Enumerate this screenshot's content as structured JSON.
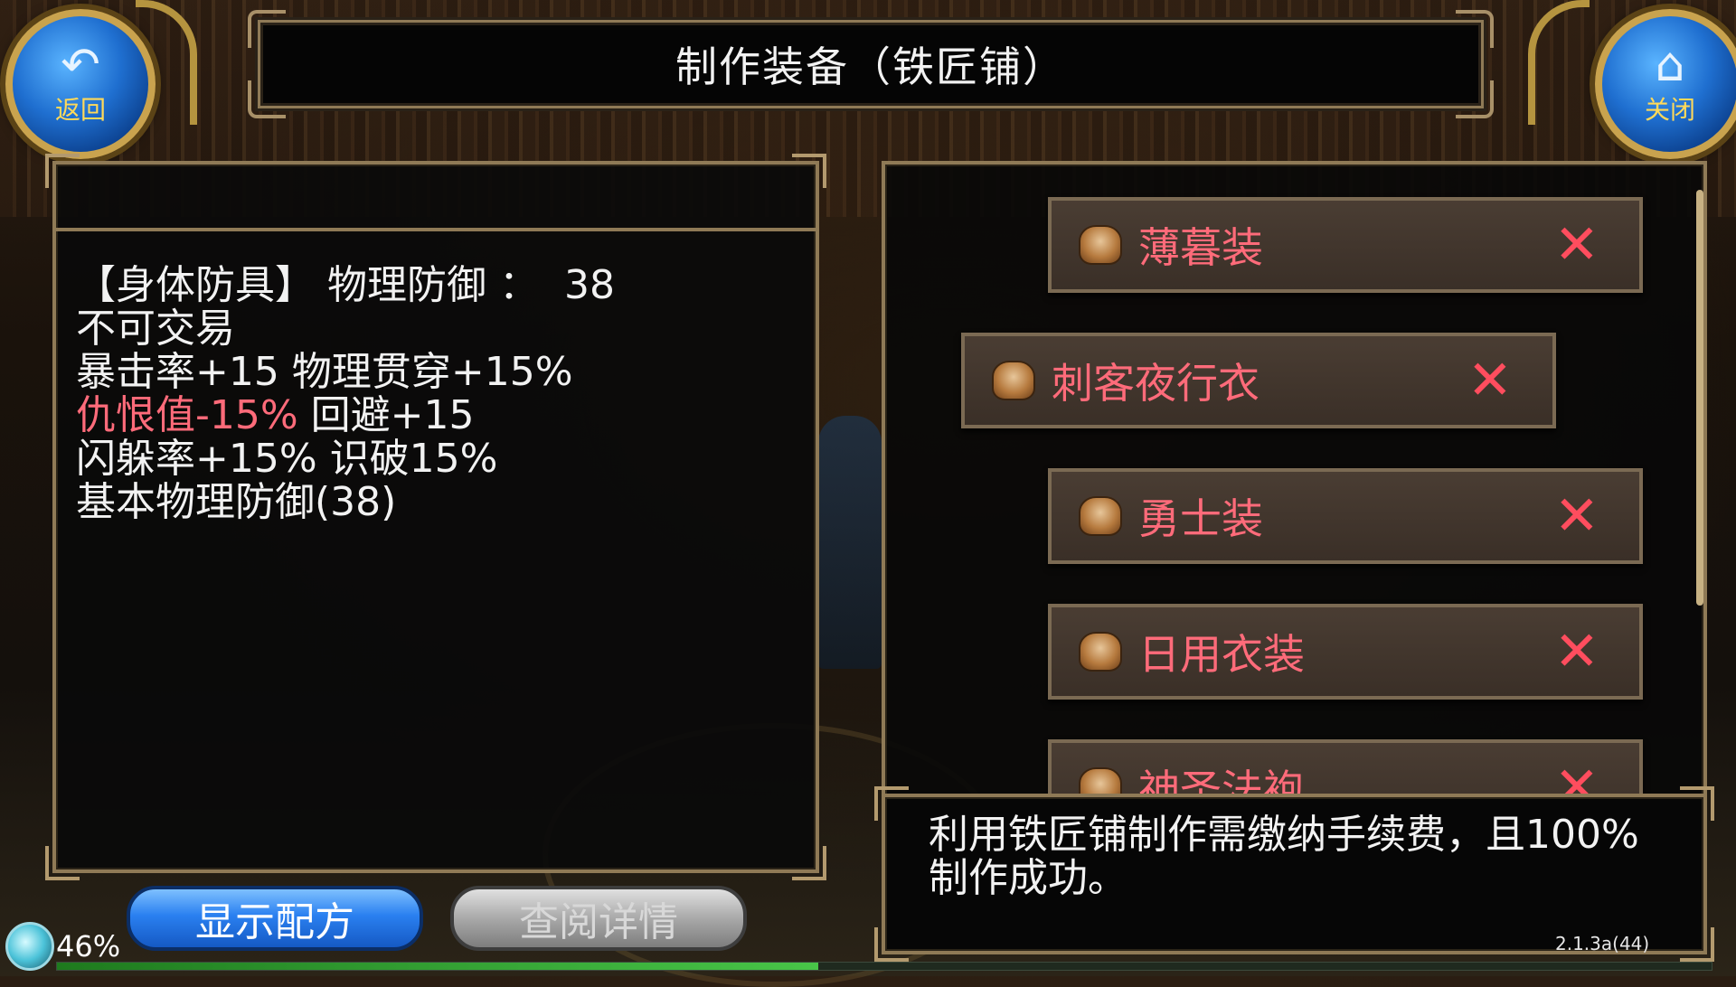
{
  "header": {
    "title": "制作装备（铁匠铺）",
    "back_label": "返回",
    "close_label": "关闭"
  },
  "item_detail": {
    "line1": "【身体防具】 物理防御 ：  38",
    "line2": "不可交易",
    "line3": "暴击率+15 物理贯穿+15%",
    "line4_red": "仇恨值-15%",
    "line4_rest": " 回避+15",
    "line5": "闪躲率+15% 识破15%",
    "line6": "基本物理防御(38)"
  },
  "recipe_list": [
    {
      "label": "薄暮装",
      "icon": "armor-icon"
    },
    {
      "label": "刺客夜行衣",
      "icon": "armor-icon"
    },
    {
      "label": "勇士装",
      "icon": "armor-icon"
    },
    {
      "label": "日用衣装",
      "icon": "armor-icon"
    },
    {
      "label": "神圣法袍",
      "icon": "armor-icon"
    }
  ],
  "info": {
    "text": "利用铁匠铺制作需缴纳手续费，且100%制作成功。"
  },
  "buttons": {
    "show_recipe": "显示配方",
    "view_detail": "查阅详情"
  },
  "status": {
    "exp_percent_label": "46%",
    "exp_fraction": 0.46,
    "version": "2.1.3a(44)"
  },
  "colors": {
    "highlight_red": "#ff6b7a",
    "x_red": "#ff4d5e",
    "frame_gold": "#8f7a56",
    "button_blue": "#2a80f0"
  }
}
